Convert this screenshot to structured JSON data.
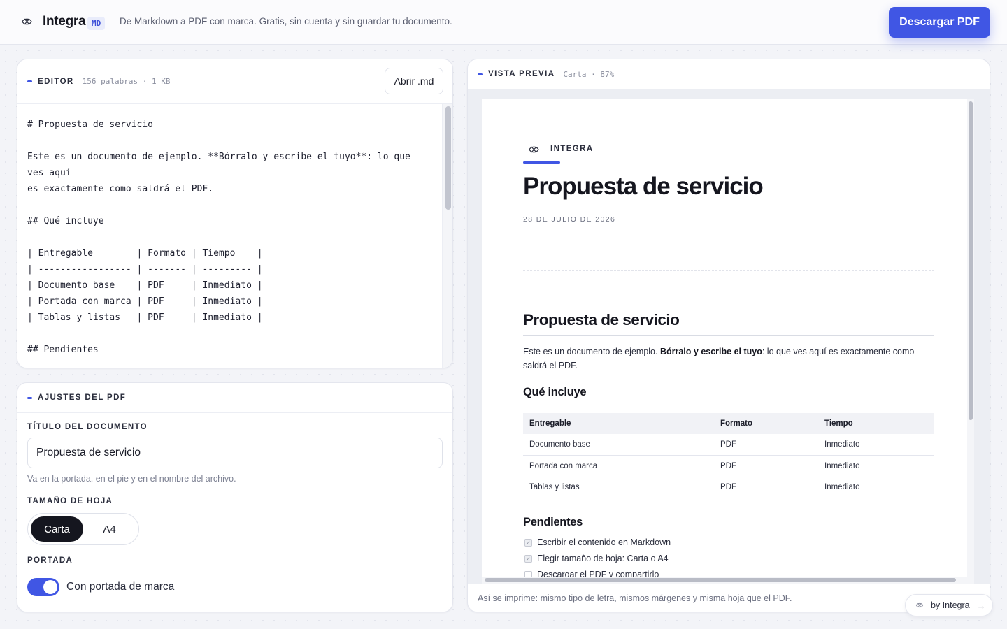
{
  "header": {
    "brand": "Integra",
    "badge": "MD",
    "tagline": "De Markdown a PDF con marca. Gratis, sin cuenta y sin guardar tu documento.",
    "download_label": "Descargar PDF"
  },
  "editor": {
    "title": "EDITOR",
    "meta": "156 palabras · 1 KB",
    "open_label": "Abrir .md",
    "lines": [
      "# Propuesta de servicio",
      "",
      "Este es un documento de ejemplo. **Bórralo y escribe el tuyo**: lo que ves aquí",
      "es exactamente como saldrá el PDF.",
      "",
      "## Qué incluye",
      "",
      "| Entregable        | Formato | Tiempo    |",
      "| ----------------- | ------- | --------- |",
      "| Documento base    | PDF     | Inmediato |",
      "| Portada con marca | PDF     | Inmediato |",
      "| Tablas y listas   | PDF     | Inmediato |",
      "",
      "## Pendientes"
    ]
  },
  "settings": {
    "title": "AJUSTES DEL PDF",
    "doc_title_label": "TÍTULO DEL DOCUMENTO",
    "doc_title_value": "Propuesta de servicio",
    "doc_title_hint": "Va en la portada, en el pie y en el nombre del archivo.",
    "size_label": "TAMAÑO DE HOJA",
    "size_options": [
      "Carta",
      "A4"
    ],
    "size_selected": "Carta",
    "cover_label": "PORTADA",
    "cover_toggle_label": "Con portada de marca",
    "cover_enabled": true
  },
  "preview": {
    "title": "VISTA PREVIA",
    "meta": "Carta · 87%",
    "footer": "Así se imprime: mismo tipo de letra, mismos márgenes y misma hoja que el PDF.",
    "doc": {
      "brand": "INTEGRA",
      "cover_title": "Propuesta de servicio",
      "date": "28 DE JULIO DE 2026",
      "h1": "Propuesta de servicio",
      "intro_before": "Este es un documento de ejemplo. ",
      "intro_bold": "Bórralo y escribe el tuyo",
      "intro_after": ": lo que ves aquí es exactamente como saldrá el PDF.",
      "h2_includes": "Qué incluye",
      "table_headers": [
        "Entregable",
        "Formato",
        "Tiempo"
      ],
      "table_rows": [
        [
          "Documento base",
          "PDF",
          "Inmediato"
        ],
        [
          "Portada con marca",
          "PDF",
          "Inmediato"
        ],
        [
          "Tablas y listas",
          "PDF",
          "Inmediato"
        ]
      ],
      "h2_pending": "Pendientes",
      "tasks": [
        {
          "text": "Escribir el contenido en Markdown",
          "checked": true
        },
        {
          "text": "Elegir tamaño de hoja: Carta o A4",
          "checked": true
        },
        {
          "text": "Descargar el PDF y compartirlo",
          "checked": false
        }
      ]
    }
  },
  "byline": "by Integra",
  "colors": {
    "accent": "#4056e4",
    "ink": "#15161f",
    "background": "#f3f4f8"
  }
}
